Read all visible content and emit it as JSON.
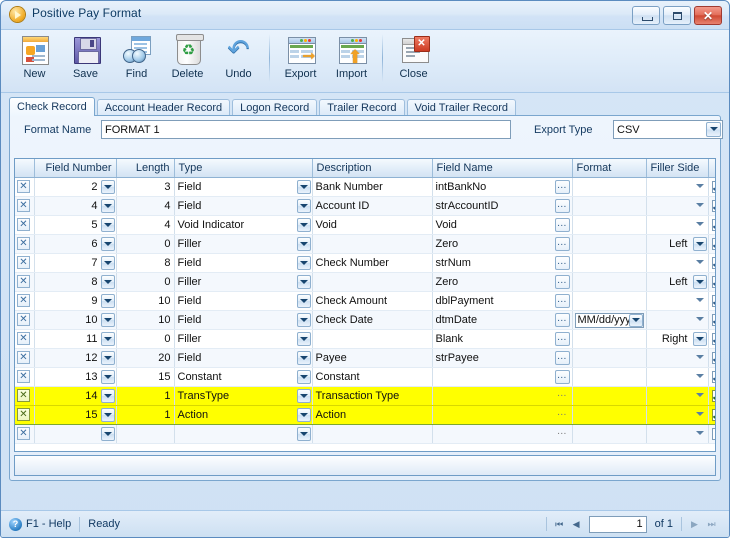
{
  "window": {
    "title": "Positive Pay Format",
    "icon": "play-circle-icon",
    "controls": {
      "minimize": "—",
      "maximize": "□",
      "close": "✕"
    }
  },
  "toolbar": {
    "items": [
      {
        "label": "New",
        "icon": "new-document-icon"
      },
      {
        "label": "Save",
        "icon": "floppy-disk-icon"
      },
      {
        "label": "Find",
        "icon": "binoculars-icon"
      },
      {
        "label": "Delete",
        "icon": "recycle-bin-icon"
      },
      {
        "label": "Undo",
        "icon": "undo-arrow-icon"
      },
      {
        "label": "Export",
        "icon": "export-grid-icon"
      },
      {
        "label": "Import",
        "icon": "import-grid-icon"
      },
      {
        "label": "Close",
        "icon": "close-window-icon"
      }
    ]
  },
  "tabs": [
    {
      "label": "Check Record",
      "active": true
    },
    {
      "label": "Account Header Record",
      "active": false
    },
    {
      "label": "Logon Record",
      "active": false
    },
    {
      "label": "Trailer Record",
      "active": false
    },
    {
      "label": "Void Trailer Record",
      "active": false
    }
  ],
  "form": {
    "format_name_label": "Format Name",
    "format_name_value": "FORMAT 1",
    "format_name_placeholder": "",
    "export_type_label": "Export Type",
    "export_type_value": "CSV"
  },
  "grid": {
    "columns": [
      "",
      "Field Number",
      "Length",
      "Type",
      "Description",
      "Field Name",
      "Format",
      "Filler Side",
      ""
    ],
    "rows": [
      {
        "field_number": "2",
        "length": "3",
        "type": "Field",
        "description": "Bank Number",
        "field_name": "intBankNo",
        "format": "",
        "filler_side": "",
        "checked": true,
        "highlight": false
      },
      {
        "field_number": "4",
        "length": "4",
        "type": "Field",
        "description": "Account ID",
        "field_name": "strAccountID",
        "format": "",
        "filler_side": "",
        "checked": true,
        "highlight": false
      },
      {
        "field_number": "5",
        "length": "4",
        "type": "Void Indicator",
        "description": "Void",
        "field_name": "Void",
        "format": "",
        "filler_side": "",
        "checked": true,
        "highlight": false
      },
      {
        "field_number": "6",
        "length": "0",
        "type": "Filler",
        "description": "",
        "field_name": "Zero",
        "format": "",
        "filler_side": "Left",
        "checked": true,
        "highlight": false
      },
      {
        "field_number": "7",
        "length": "8",
        "type": "Field",
        "description": "Check Number",
        "field_name": "strNum",
        "format": "",
        "filler_side": "",
        "checked": true,
        "highlight": false
      },
      {
        "field_number": "8",
        "length": "0",
        "type": "Filler",
        "description": "",
        "field_name": "Zero",
        "format": "",
        "filler_side": "Left",
        "checked": true,
        "highlight": false
      },
      {
        "field_number": "9",
        "length": "10",
        "type": "Field",
        "description": "Check Amount",
        "field_name": "dblPayment",
        "format": "",
        "filler_side": "",
        "checked": true,
        "highlight": false
      },
      {
        "field_number": "10",
        "length": "10",
        "type": "Field",
        "description": "Check Date",
        "field_name": "dtmDate",
        "format": "MM/dd/yyyy",
        "filler_side": "",
        "checked": true,
        "highlight": false
      },
      {
        "field_number": "11",
        "length": "0",
        "type": "Filler",
        "description": "",
        "field_name": "Blank",
        "format": "",
        "filler_side": "Right",
        "checked": true,
        "highlight": false
      },
      {
        "field_number": "12",
        "length": "20",
        "type": "Field",
        "description": "Payee",
        "field_name": "strPayee",
        "format": "",
        "filler_side": "",
        "checked": true,
        "highlight": false
      },
      {
        "field_number": "13",
        "length": "15",
        "type": "Constant",
        "description": "Constant",
        "field_name": "",
        "format": "",
        "filler_side": "",
        "checked": true,
        "highlight": false
      },
      {
        "field_number": "14",
        "length": "1",
        "type": "TransType",
        "description": "Transaction Type",
        "field_name": "",
        "format": "",
        "filler_side": "",
        "checked": true,
        "highlight": true
      },
      {
        "field_number": "15",
        "length": "1",
        "type": "Action",
        "description": "Action",
        "field_name": "",
        "format": "",
        "filler_side": "",
        "checked": true,
        "highlight": true
      },
      {
        "field_number": "",
        "length": "",
        "type": "",
        "description": "",
        "field_name": "",
        "format": "",
        "filler_side": "",
        "checked": false,
        "highlight": false
      }
    ],
    "row_delete_glyph": "✕",
    "ellipsis_glyph": "…"
  },
  "statusbar": {
    "help_icon": "question-mark-icon",
    "help_label": "F1 - Help",
    "status": "Ready",
    "pager": {
      "first": "⏮",
      "prev": "◀",
      "page": "1",
      "of_label": "of 1",
      "next": "▶",
      "last": "⏭"
    }
  },
  "colors": {
    "accent": "#5b8bbf",
    "highlight_row": "#ffff00",
    "highlight_border": "#7ea82e",
    "title_text": "#0d3a63",
    "close_button": "#cf4a33"
  }
}
